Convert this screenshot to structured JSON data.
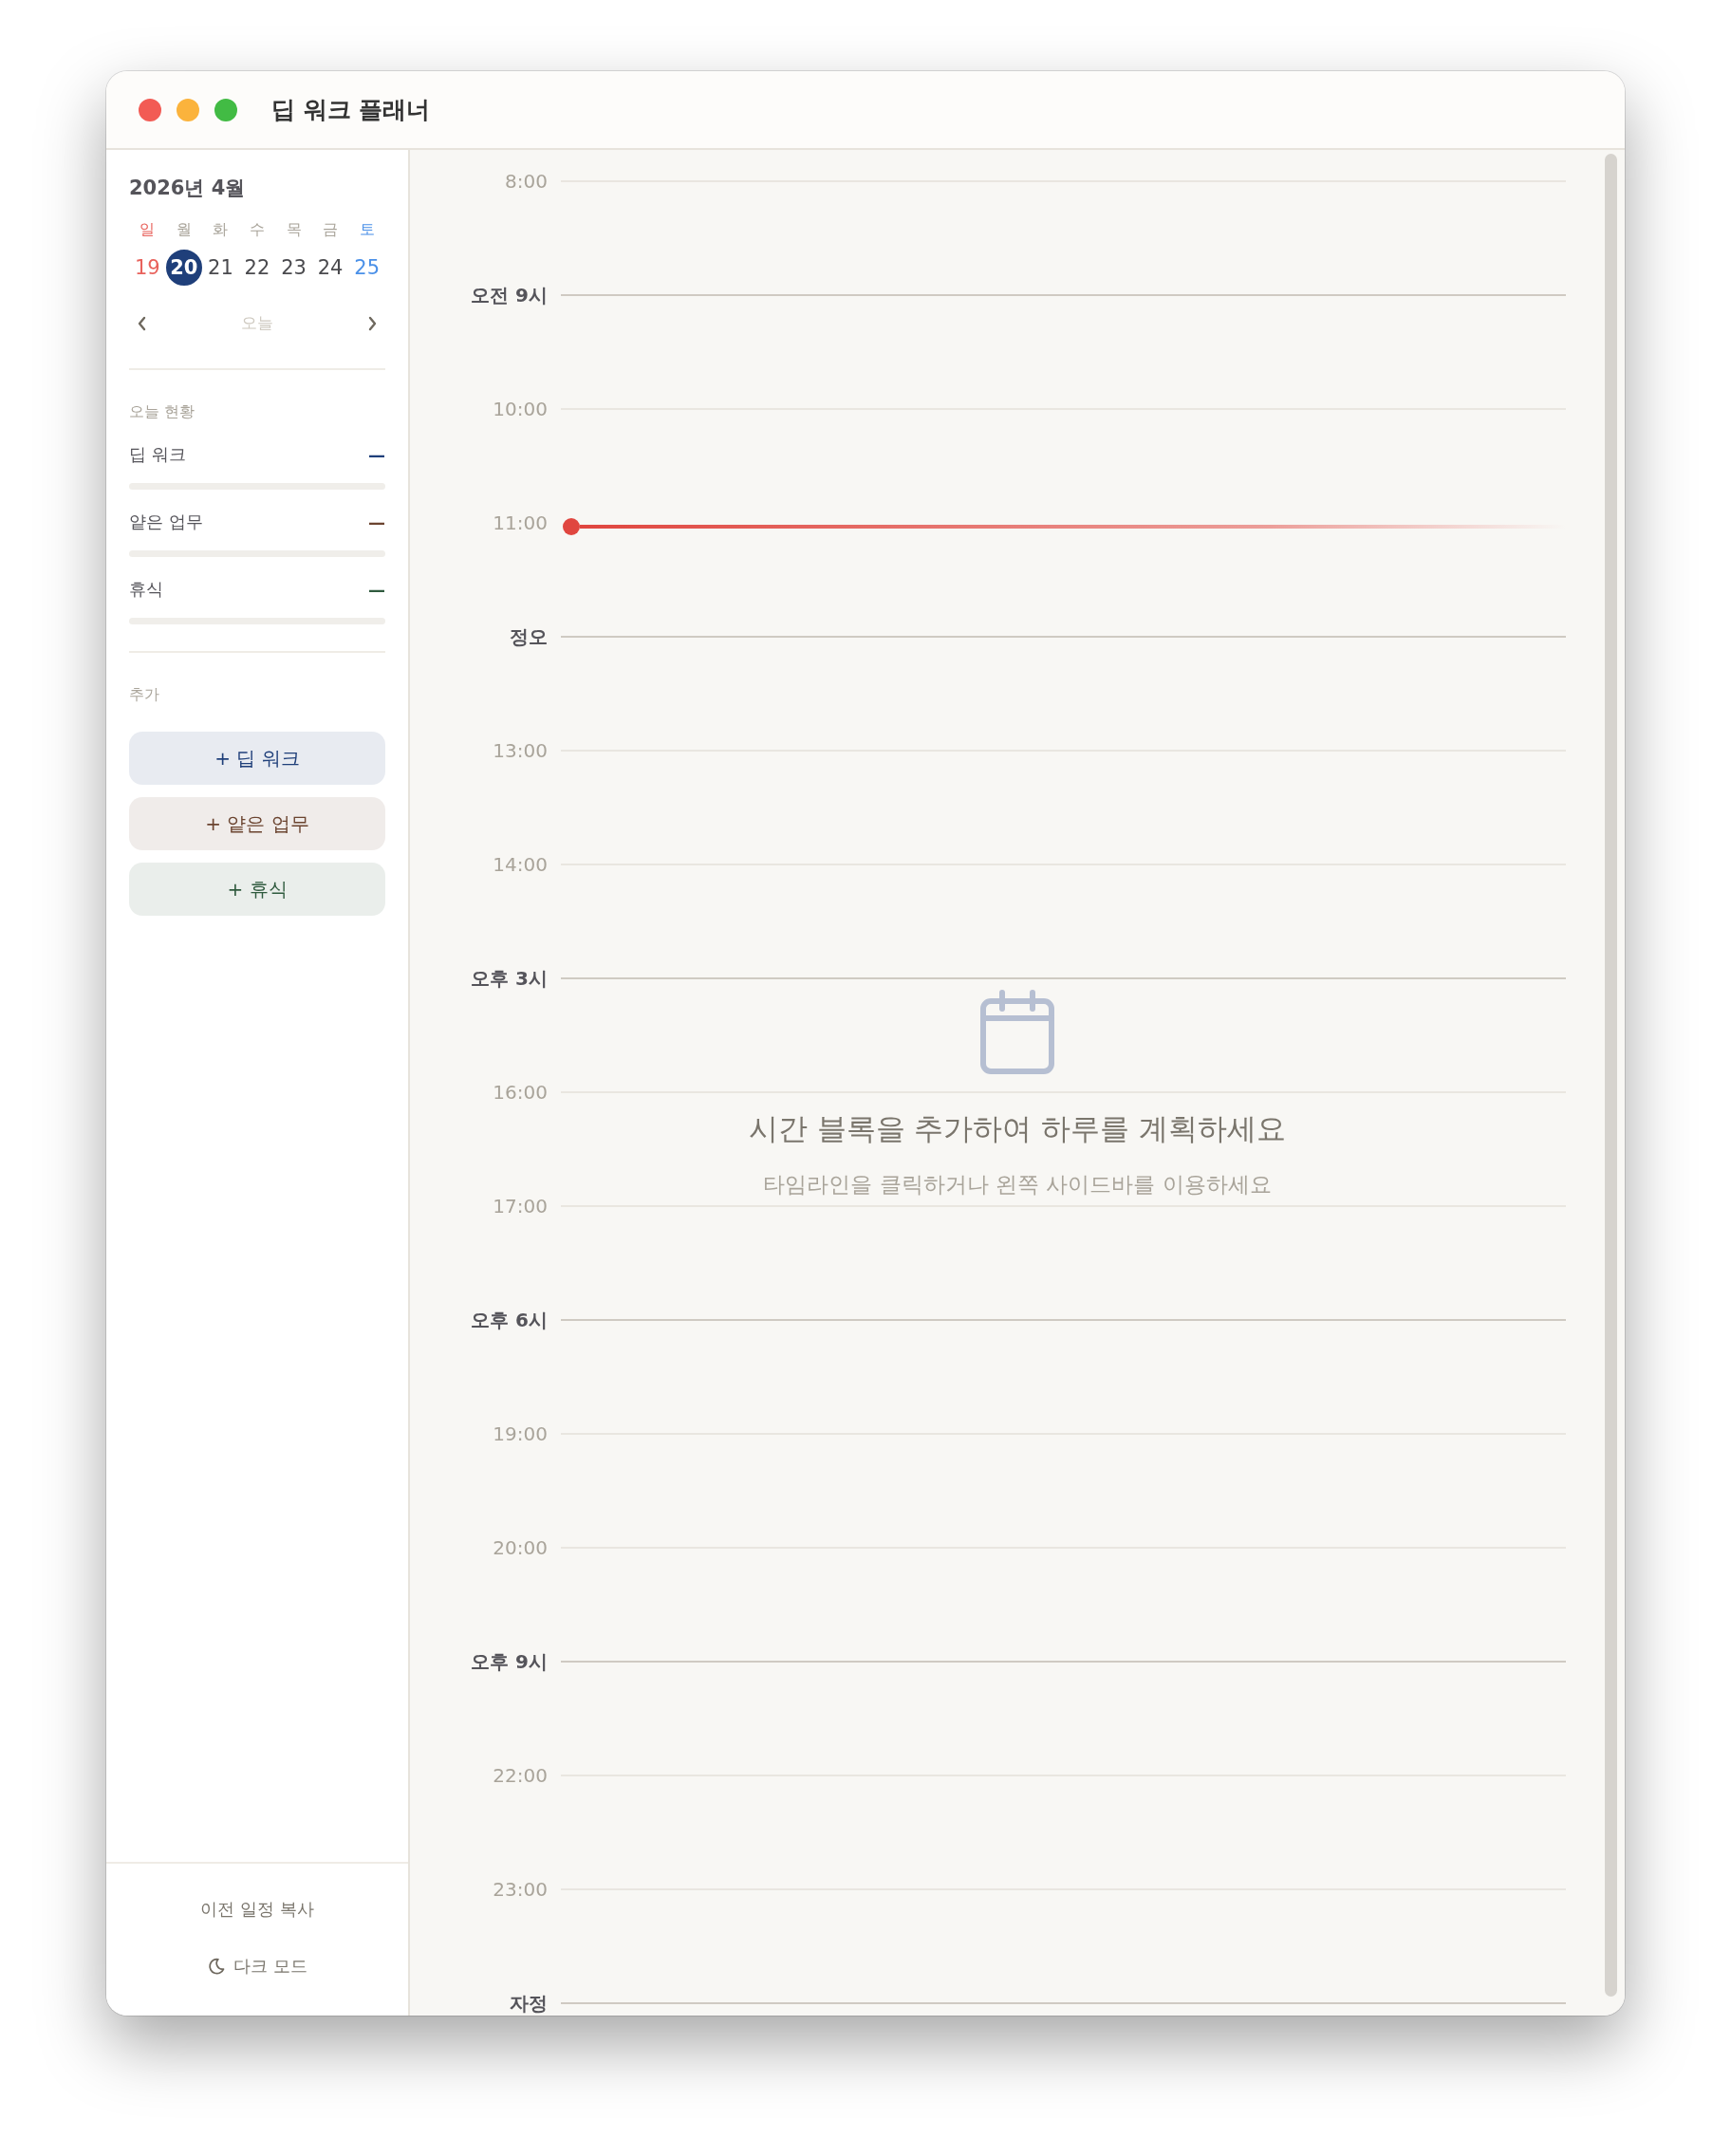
{
  "window": {
    "title": "딥 워크 플래너"
  },
  "calendar": {
    "month": "2026년 4월",
    "weekdays": [
      {
        "label": "일",
        "kind": "sunday"
      },
      {
        "label": "월",
        "kind": "weekday"
      },
      {
        "label": "화",
        "kind": "weekday"
      },
      {
        "label": "수",
        "kind": "weekday"
      },
      {
        "label": "목",
        "kind": "weekday"
      },
      {
        "label": "금",
        "kind": "weekday"
      },
      {
        "label": "토",
        "kind": "saturday"
      }
    ],
    "dates": [
      {
        "label": "19",
        "kind": "sunday",
        "selected": false
      },
      {
        "label": "20",
        "kind": "weekday",
        "selected": true
      },
      {
        "label": "21",
        "kind": "weekday",
        "selected": false
      },
      {
        "label": "22",
        "kind": "weekday",
        "selected": false
      },
      {
        "label": "23",
        "kind": "weekday",
        "selected": false
      },
      {
        "label": "24",
        "kind": "weekday",
        "selected": false
      },
      {
        "label": "25",
        "kind": "saturday",
        "selected": false
      }
    ],
    "today_button": "오늘"
  },
  "status": {
    "heading": "오늘 현황",
    "items": [
      {
        "label": "딥 워크",
        "value": "—",
        "color": "#1f3f7a",
        "level": 0
      },
      {
        "label": "얕은 업무",
        "value": "—",
        "color": "#6b4430",
        "level": 0
      },
      {
        "label": "휴식",
        "value": "—",
        "color": "#2f5a3e",
        "level": 0
      }
    ]
  },
  "add": {
    "heading": "추가",
    "buttons": [
      {
        "label": "+ 딥 워크",
        "color": "#1f3f7a"
      },
      {
        "label": "+ 얕은 업무",
        "color": "#6b4430"
      },
      {
        "label": "+ 휴식",
        "color": "#2f5a3e"
      }
    ]
  },
  "footer": {
    "copy_button": "이전 일정 복사",
    "dark_mode_button": "다크 모드"
  },
  "timeline": {
    "hours": [
      {
        "label": "8:00",
        "major": false,
        "now": false
      },
      {
        "label": "오전 9시",
        "major": true,
        "now": false
      },
      {
        "label": "10:00",
        "major": false,
        "now": false
      },
      {
        "label": "11:00",
        "major": false,
        "now": true
      },
      {
        "label": "정오",
        "major": true,
        "now": false
      },
      {
        "label": "13:00",
        "major": false,
        "now": false
      },
      {
        "label": "14:00",
        "major": false,
        "now": false
      },
      {
        "label": "오후 3시",
        "major": true,
        "now": false
      },
      {
        "label": "16:00",
        "major": false,
        "now": false
      },
      {
        "label": "17:00",
        "major": false,
        "now": false
      },
      {
        "label": "오후 6시",
        "major": true,
        "now": false
      },
      {
        "label": "19:00",
        "major": false,
        "now": false
      },
      {
        "label": "20:00",
        "major": false,
        "now": false
      },
      {
        "label": "오후 9시",
        "major": true,
        "now": false
      },
      {
        "label": "22:00",
        "major": false,
        "now": false
      },
      {
        "label": "23:00",
        "major": false,
        "now": false
      },
      {
        "label": "자정",
        "major": true,
        "now": false
      }
    ],
    "empty_state": {
      "title": "시간 블록을 추가하여 하루를 계획하세요",
      "subtitle": "타임라인을 클릭하거나 왼쪽 사이드바를 이용하세요"
    }
  }
}
